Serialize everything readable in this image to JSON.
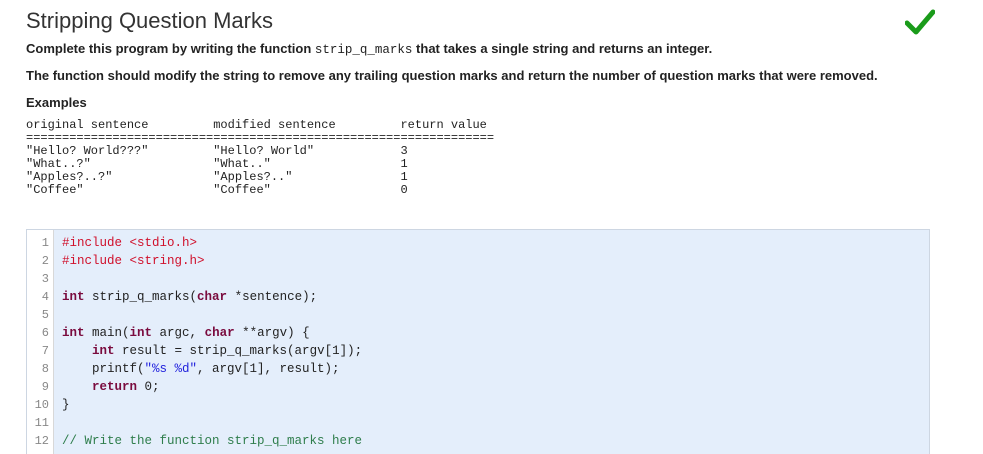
{
  "problem": {
    "title": "Stripping Question Marks",
    "status_icon": "checkmark-icon",
    "status_color": "#1a9b1a",
    "desc_prefix": "Complete this program by writing the function ",
    "desc_func": "strip_q_marks",
    "desc_suffix": " that takes a single string and returns an integer.",
    "desc2": "The function should modify the string to remove any trailing question marks and return the number of question marks that were removed.",
    "examples_heading": "Examples",
    "examples_table": "original sentence         modified sentence         return value\n=================================================================\n\"Hello? World???\"         \"Hello? World\"            3\n\"What..?\"                 \"What..\"                  1\n\"Apples?..?\"              \"Apples?..\"               1\n\"Coffee\"                  \"Coffee\"                  0"
  },
  "editor": {
    "lines": [
      {
        "n": "1",
        "t": "#include <stdio.h>"
      },
      {
        "n": "2",
        "t": "#include <string.h>"
      },
      {
        "n": "3",
        "t": ""
      },
      {
        "n": "4",
        "t": "int strip_q_marks(char *sentence);"
      },
      {
        "n": "5",
        "t": ""
      },
      {
        "n": "6",
        "t": "int main(int argc, char **argv) {"
      },
      {
        "n": "7",
        "t": "    int result = strip_q_marks(argv[1]);"
      },
      {
        "n": "8",
        "t": "    printf(\"%s %d\", argv[1], result);"
      },
      {
        "n": "9",
        "t": "    return 0;"
      },
      {
        "n": "10",
        "t": "}"
      },
      {
        "n": "11",
        "t": ""
      },
      {
        "n": "12",
        "t": "// Write the function strip_q_marks here"
      }
    ]
  }
}
